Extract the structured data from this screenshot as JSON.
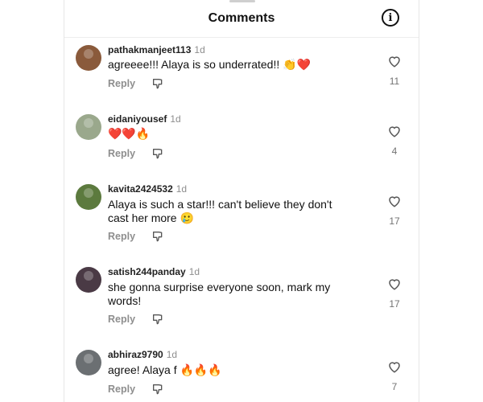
{
  "header": {
    "title": "Comments",
    "info_icon": "info-icon"
  },
  "comments": [
    {
      "username": "pathakmanjeet113",
      "time": "1d",
      "text": "agreeee!!! Alaya is so underrated!! 👏❤️",
      "reply_label": "Reply",
      "like_count": "11",
      "avatar_color": "#8a5a3b"
    },
    {
      "username": "eidaniyousef",
      "time": "1d",
      "text": "❤️❤️🔥",
      "reply_label": "Reply",
      "like_count": "4",
      "avatar_color": "#9aa88c"
    },
    {
      "username": "kavita2424532",
      "time": "1d",
      "text": "Alaya is such a star!!! can't believe they don't cast her more 🥲",
      "reply_label": "Reply",
      "like_count": "17",
      "avatar_color": "#5c7a3e"
    },
    {
      "username": "satish244panday",
      "time": "1d",
      "text": "she gonna surprise everyone soon, mark my words!",
      "reply_label": "Reply",
      "like_count": "17",
      "avatar_color": "#4a3a45"
    },
    {
      "username": "abhiraz9790",
      "time": "1d",
      "text": "agree! Alaya f 🔥🔥🔥",
      "reply_label": "Reply",
      "like_count": "7",
      "avatar_color": "#6b6f72"
    }
  ]
}
